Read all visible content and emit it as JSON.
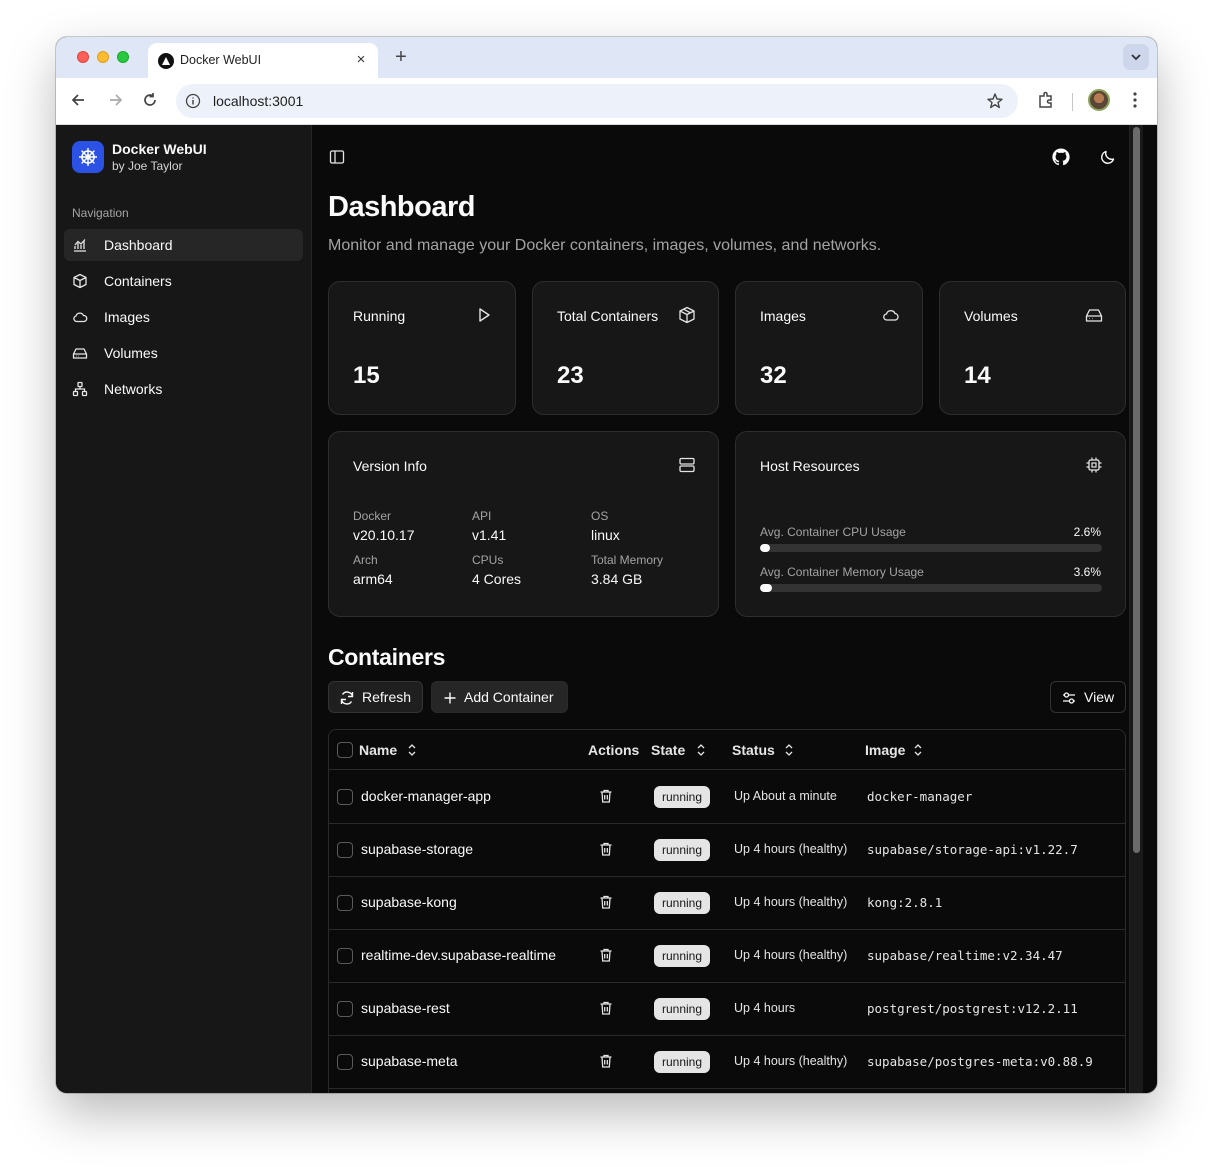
{
  "browser": {
    "tab_title": "Docker WebUI",
    "tab_close": "×",
    "new_tab": "+",
    "url": "localhost:3001"
  },
  "sidebar": {
    "brand_name": "Docker WebUI",
    "brand_sub": "by Joe Taylor",
    "nav_label": "Navigation",
    "items": [
      {
        "label": "Dashboard",
        "icon": "chart-icon",
        "active": true
      },
      {
        "label": "Containers",
        "icon": "box-icon",
        "active": false
      },
      {
        "label": "Images",
        "icon": "cloud-icon",
        "active": false
      },
      {
        "label": "Volumes",
        "icon": "hard-drive-icon",
        "active": false
      },
      {
        "label": "Networks",
        "icon": "network-icon",
        "active": false
      }
    ]
  },
  "header": {
    "title": "Dashboard",
    "subtitle": "Monitor and manage your Docker containers, images, volumes, and networks."
  },
  "stats": [
    {
      "label": "Running",
      "value": "15",
      "icon": "play-icon"
    },
    {
      "label": "Total Containers",
      "value": "23",
      "icon": "box-icon"
    },
    {
      "label": "Images",
      "value": "32",
      "icon": "cloud-icon"
    },
    {
      "label": "Volumes",
      "value": "14",
      "icon": "hard-drive-icon"
    }
  ],
  "version_info": {
    "title": "Version Info",
    "fields": [
      {
        "label": "Docker",
        "value": "v20.10.17"
      },
      {
        "label": "API",
        "value": "v1.41"
      },
      {
        "label": "OS",
        "value": "linux"
      },
      {
        "label": "Arch",
        "value": "arm64"
      },
      {
        "label": "CPUs",
        "value": "4 Cores"
      },
      {
        "label": "Total Memory",
        "value": "3.84 GB"
      }
    ]
  },
  "host_resources": {
    "title": "Host Resources",
    "cpu": {
      "label": "Avg. Container CPU Usage",
      "value": "2.6%",
      "percent": 2.6
    },
    "memory": {
      "label": "Avg. Container Memory Usage",
      "value": "3.6%",
      "percent": 3.6
    }
  },
  "containers": {
    "title": "Containers",
    "refresh_label": "Refresh",
    "add_label": "Add Container",
    "view_label": "View",
    "columns": {
      "name": "Name",
      "actions": "Actions",
      "state": "State",
      "status": "Status",
      "image": "Image"
    },
    "rows": [
      {
        "name": "docker-manager-app",
        "state": "running",
        "status": "Up About a minute",
        "image": "docker-manager"
      },
      {
        "name": "supabase-storage",
        "state": "running",
        "status": "Up 4 hours (healthy)",
        "image": "supabase/storage-api:v1.22.7"
      },
      {
        "name": "supabase-kong",
        "state": "running",
        "status": "Up 4 hours (healthy)",
        "image": "kong:2.8.1"
      },
      {
        "name": "realtime-dev.supabase-realtime",
        "state": "running",
        "status": "Up 4 hours (healthy)",
        "image": "supabase/realtime:v2.34.47"
      },
      {
        "name": "supabase-rest",
        "state": "running",
        "status": "Up 4 hours",
        "image": "postgrest/postgrest:v12.2.11"
      },
      {
        "name": "supabase-meta",
        "state": "running",
        "status": "Up 4 hours (healthy)",
        "image": "supabase/postgres-meta:v0.88.9"
      }
    ]
  },
  "colors": {
    "background": "#0a0a0a",
    "sidebar": "#171717",
    "brand": "#2b52e5",
    "badge": "#e5e5e5"
  }
}
